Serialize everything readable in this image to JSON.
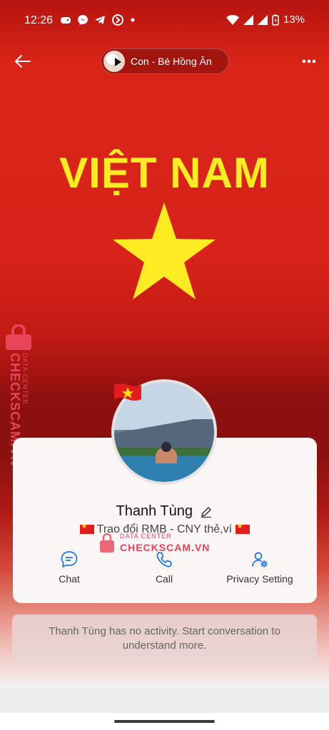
{
  "status": {
    "time": "12:26",
    "battery": "13%"
  },
  "header": {
    "music_title": "Con - Bé Hồng Ân"
  },
  "cover": {
    "title": "VIỆT NAM"
  },
  "watermark": {
    "brand": "CHECKSCAM.VN",
    "sub": "DATA CENTER"
  },
  "profile": {
    "name": "Thanh Tùng",
    "bio": "Trao đổi RMB - CNY thẻ,ví"
  },
  "actions": [
    {
      "label": "Chat",
      "icon": "chat-bubble-icon"
    },
    {
      "label": "Call",
      "icon": "phone-icon"
    },
    {
      "label": "Privacy Setting",
      "icon": "user-settings-icon"
    }
  ],
  "activity": {
    "text": "Thanh Tùng has no activity. Start conversation to understand more."
  },
  "colors": {
    "cover_red": "#da2418",
    "title_yellow": "#ffeb24",
    "accent_blue": "#1a73e8",
    "watermark_pink": "#e8455a"
  }
}
